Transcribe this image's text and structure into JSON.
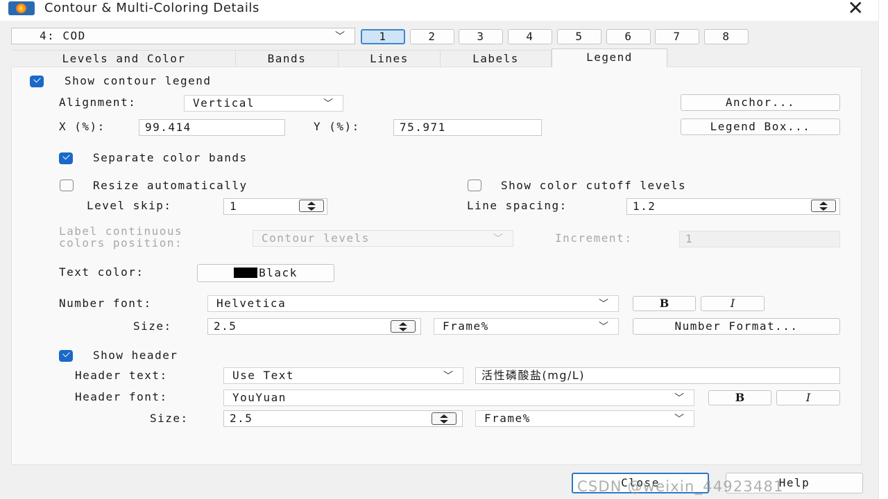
{
  "window": {
    "title": "Contour & Multi-Coloring Details"
  },
  "zone_select": {
    "value": "4:  COD"
  },
  "zone_buttons": [
    "1",
    "2",
    "3",
    "4",
    "5",
    "6",
    "7",
    "8"
  ],
  "tabs": [
    "Levels and Color",
    "Bands",
    "Lines",
    "Labels",
    "Legend"
  ],
  "legend": {
    "show_legend_label": "Show contour legend",
    "show_legend_checked": true,
    "alignment_label": "Alignment:",
    "alignment_value": "Vertical",
    "anchor_button": "Anchor...",
    "x_label": "X (%):",
    "x_value": "99.414",
    "y_label": "Y (%):",
    "y_value": "75.971",
    "legend_box_button": "Legend Box...",
    "separate_bands_label": "Separate color bands",
    "separate_bands_checked": true,
    "resize_label": "Resize automatically",
    "resize_checked": false,
    "cutoff_label": "Show color cutoff levels",
    "cutoff_checked": false,
    "level_skip_label": "Level skip:",
    "level_skip_value": "1",
    "line_spacing_label": "Line spacing:",
    "line_spacing_value": "1.2",
    "label_cont_line1": "Label continuous",
    "label_cont_line2": "colors position:",
    "label_cont_value": "Contour levels",
    "increment_label": "Increment:",
    "increment_value": "1",
    "text_color_label": "Text color:",
    "text_color_value": "Black",
    "text_color_hex": "#000000",
    "number_font_label": "Number font:",
    "number_font_value": "Helvetica",
    "bold_label": "B",
    "italic_label": "I",
    "size_label": "Size:",
    "number_size_value": "2.5",
    "number_size_units": "Frame%",
    "number_format_button": "Number Format...",
    "show_header_label": "Show header",
    "show_header_checked": true,
    "header_text_label": "Header text:",
    "header_text_mode": "Use Text",
    "header_text_value": "活性磷酸盐(mg/L)",
    "header_font_label": "Header font:",
    "header_font_value": "YouYuan",
    "header_size_value": "2.5",
    "header_size_units": "Frame%"
  },
  "footer": {
    "close_button": "Close",
    "help_button": "Help"
  },
  "watermark": "CSDN @weixin_44923481",
  "colors": {
    "accent": "#1a68c7",
    "active_zone": "#cfe4f7"
  }
}
